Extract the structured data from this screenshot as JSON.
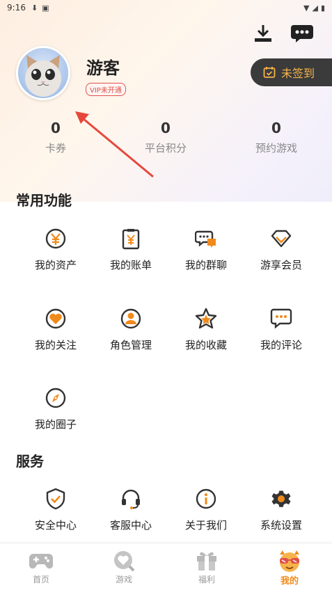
{
  "status_bar": {
    "time": "9:16"
  },
  "profile": {
    "username": "游客",
    "vip_status": "VIP未开通",
    "checkin_label": "未签到"
  },
  "stats": [
    {
      "value": "0",
      "label": "卡券"
    },
    {
      "value": "0",
      "label": "平台积分"
    },
    {
      "value": "0",
      "label": "预约游戏"
    }
  ],
  "common_functions": {
    "title": "常用功能",
    "items": [
      {
        "label": "我的资产",
        "icon": "yen-coin-icon"
      },
      {
        "label": "我的账单",
        "icon": "bill-clipboard-icon"
      },
      {
        "label": "我的群聊",
        "icon": "group-chat-icon"
      },
      {
        "label": "游享会员",
        "icon": "diamond-icon"
      },
      {
        "label": "我的关注",
        "icon": "heart-icon"
      },
      {
        "label": "角色管理",
        "icon": "user-role-icon"
      },
      {
        "label": "我的收藏",
        "icon": "star-icon"
      },
      {
        "label": "我的评论",
        "icon": "comment-icon"
      },
      {
        "label": "我的圈子",
        "icon": "compass-icon"
      }
    ]
  },
  "services": {
    "title": "服务",
    "items": [
      {
        "label": "安全中心",
        "icon": "shield-check-icon"
      },
      {
        "label": "客服中心",
        "icon": "headset-icon"
      },
      {
        "label": "关于我们",
        "icon": "info-icon"
      },
      {
        "label": "系统设置",
        "icon": "gear-icon"
      }
    ]
  },
  "bottom_nav": [
    {
      "label": "首页",
      "icon": "gamepad-icon",
      "active": false
    },
    {
      "label": "游戏",
      "icon": "game-search-icon",
      "active": false
    },
    {
      "label": "福利",
      "icon": "gift-icon",
      "active": false
    },
    {
      "label": "我的",
      "icon": "mascot-face-icon",
      "active": true
    }
  ],
  "colors": {
    "accent": "#f08a1c",
    "icon_dark": "#333333",
    "checkin_bg": "#3b3b3b",
    "checkin_text": "#f7b34a",
    "vip_red": "#e0504a",
    "annotation_arrow": "#e5483b"
  }
}
